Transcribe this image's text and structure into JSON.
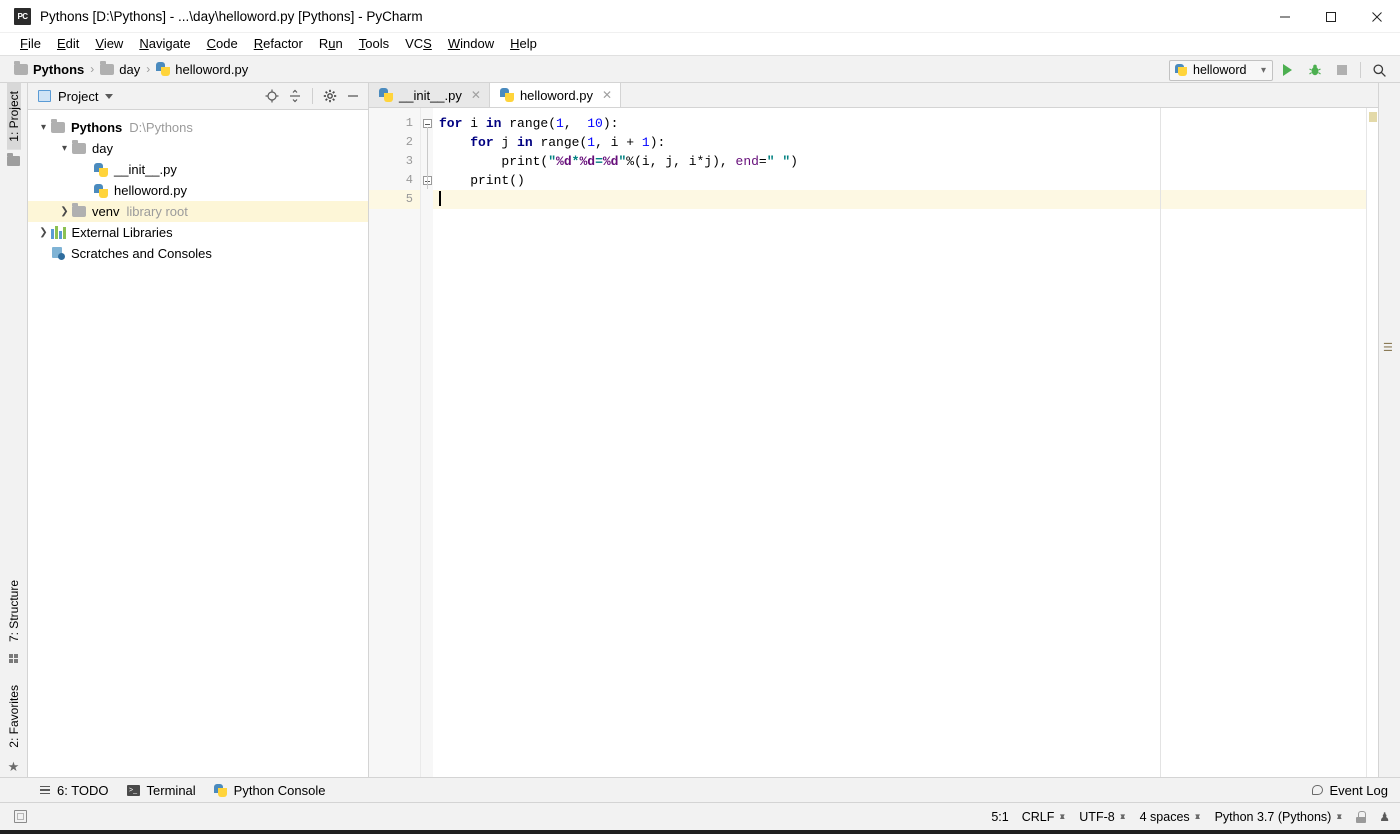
{
  "window": {
    "title": "Pythons [D:\\Pythons] - ...\\day\\helloword.py [Pythons] - PyCharm",
    "app_icon": "PC",
    "controls": {
      "minimize": "—",
      "maximize": "☐",
      "close": "✕"
    }
  },
  "menubar": {
    "items": [
      {
        "label": "File",
        "mnemonic": "F"
      },
      {
        "label": "Edit",
        "mnemonic": "E"
      },
      {
        "label": "View",
        "mnemonic": "V"
      },
      {
        "label": "Navigate",
        "mnemonic": "N"
      },
      {
        "label": "Code",
        "mnemonic": "C"
      },
      {
        "label": "Refactor",
        "mnemonic": "R"
      },
      {
        "label": "Run",
        "mnemonic": "u"
      },
      {
        "label": "Tools",
        "mnemonic": "T"
      },
      {
        "label": "VCS",
        "mnemonic": "S"
      },
      {
        "label": "Window",
        "mnemonic": "W"
      },
      {
        "label": "Help",
        "mnemonic": "H"
      }
    ]
  },
  "navbar": {
    "breadcrumb": [
      {
        "label": "Pythons",
        "icon": "folder-icon",
        "bold": true
      },
      {
        "label": "day",
        "icon": "folder-icon",
        "bold": false
      },
      {
        "label": "helloword.py",
        "icon": "python-file-icon",
        "bold": false
      }
    ],
    "separator": "›",
    "run_config": {
      "name": "helloword",
      "icon": "python-config-icon",
      "chevron": "⌄"
    },
    "buttons": [
      {
        "name": "run-button",
        "icon": "run-triangle-icon"
      },
      {
        "name": "debug-button",
        "icon": "bug-icon"
      },
      {
        "name": "stop-button",
        "icon": "stop-square-icon"
      },
      {
        "name": "search-everywhere-button",
        "icon": "search-icon",
        "glyph": "⌕"
      }
    ]
  },
  "left_rail": {
    "top": [
      {
        "label": "1: Project",
        "active": true
      }
    ],
    "bottom": [
      {
        "label": "7: Structure",
        "icon": "structure-dots-icon"
      },
      {
        "label": "2: Favorites",
        "icon": "star-icon"
      }
    ]
  },
  "project_panel": {
    "title": "Project",
    "tools": [
      {
        "name": "locate-button",
        "glyph": "⊕"
      },
      {
        "name": "collapse-all-button",
        "glyph": "≃"
      },
      {
        "name": "settings-button",
        "glyph": "⚙"
      },
      {
        "name": "hide-button",
        "glyph": "—"
      }
    ],
    "tree": [
      {
        "label": "Pythons",
        "path": "D:\\Pythons",
        "icon": "folder-icon",
        "arrow": "⌄",
        "depth": 0,
        "bold": true,
        "selected": false
      },
      {
        "label": "day",
        "path": "",
        "icon": "folder-icon",
        "arrow": "⌄",
        "depth": 1,
        "bold": false,
        "selected": false
      },
      {
        "label": "__init__.py",
        "path": "",
        "icon": "python-file-icon",
        "arrow": "",
        "depth": 2,
        "bold": false,
        "selected": false
      },
      {
        "label": "helloword.py",
        "path": "",
        "icon": "python-file-icon",
        "arrow": "",
        "depth": 2,
        "bold": false,
        "selected": false
      },
      {
        "label": "venv",
        "path": "library root",
        "icon": "folder-icon",
        "arrow": "›",
        "depth": 1,
        "bold": false,
        "selected": true
      },
      {
        "label": "External Libraries",
        "path": "",
        "icon": "libraries-icon",
        "arrow": "›",
        "depth": 0,
        "bold": false,
        "selected": false
      },
      {
        "label": "Scratches and Consoles",
        "path": "",
        "icon": "scratches-icon",
        "arrow": "",
        "depth": 0,
        "bold": false,
        "selected": false
      }
    ]
  },
  "editor": {
    "tabs": [
      {
        "label": "__init__.py",
        "icon": "python-file-icon",
        "active": false,
        "close": "✕"
      },
      {
        "label": "helloword.py",
        "icon": "python-file-icon",
        "active": true,
        "close": "✕"
      }
    ],
    "line_numbers": [
      "1",
      "2",
      "3",
      "4",
      "5"
    ],
    "current_line": 5,
    "lines": [
      {
        "n": 1,
        "tokens": [
          {
            "t": "for",
            "c": "kw"
          },
          {
            "t": " i ",
            "c": ""
          },
          {
            "t": "in",
            "c": "kw"
          },
          {
            "t": " range(",
            "c": ""
          },
          {
            "t": "1",
            "c": "num"
          },
          {
            "t": ",  ",
            "c": ""
          },
          {
            "t": "10",
            "c": "num"
          },
          {
            "t": "):",
            "c": ""
          }
        ]
      },
      {
        "n": 2,
        "tokens": [
          {
            "t": "    ",
            "c": ""
          },
          {
            "t": "for",
            "c": "kw"
          },
          {
            "t": " j ",
            "c": ""
          },
          {
            "t": "in",
            "c": "kw"
          },
          {
            "t": " range(",
            "c": ""
          },
          {
            "t": "1",
            "c": "num"
          },
          {
            "t": ", i + ",
            "c": ""
          },
          {
            "t": "1",
            "c": "num"
          },
          {
            "t": "):",
            "c": ""
          }
        ]
      },
      {
        "n": 3,
        "tokens": [
          {
            "t": "        print(",
            "c": ""
          },
          {
            "t": "\"",
            "c": "str"
          },
          {
            "t": "%d",
            "c": "pct"
          },
          {
            "t": "*",
            "c": "str"
          },
          {
            "t": "%d",
            "c": "pct"
          },
          {
            "t": "=",
            "c": "str"
          },
          {
            "t": "%d",
            "c": "pct"
          },
          {
            "t": "\"",
            "c": "str"
          },
          {
            "t": "%(i, j, i*j), ",
            "c": ""
          },
          {
            "t": "end",
            "c": "kwarg"
          },
          {
            "t": "=",
            "c": ""
          },
          {
            "t": "\" \"",
            "c": "str"
          },
          {
            "t": ")",
            "c": ""
          }
        ]
      },
      {
        "n": 4,
        "tokens": [
          {
            "t": "    print()",
            "c": ""
          }
        ]
      },
      {
        "n": 5,
        "tokens": []
      }
    ],
    "folds": [
      {
        "line": 1
      },
      {
        "line": 4
      }
    ]
  },
  "tool_windows": {
    "items": [
      {
        "label": "6: TODO",
        "icon": "list-icon",
        "mnemonic": "6"
      },
      {
        "label": "Terminal",
        "icon": "terminal-icon"
      },
      {
        "label": "Python Console",
        "icon": "python-console-icon"
      }
    ],
    "event_log": {
      "label": "Event Log",
      "icon": "bubble-icon"
    }
  },
  "statusbar": {
    "caret_position": "5:1",
    "line_separator": "CRLF",
    "encoding": "UTF-8",
    "indent": "4 spaces",
    "interpreter": "Python 3.7 (Pythons)",
    "lock_icon": "lock-icon",
    "hector_icon": "hector-icon",
    "left_icon": "toggle-toolwindows-icon"
  },
  "colors": {
    "accent_run": "#4caf50",
    "selection": "#fdf6d7",
    "current_line": "#fdf8e3",
    "keyword": "#000080",
    "string": "#008080",
    "number": "#0000ff",
    "format_spec": "#660e7a",
    "panel_bg": "#f2f2f2"
  }
}
